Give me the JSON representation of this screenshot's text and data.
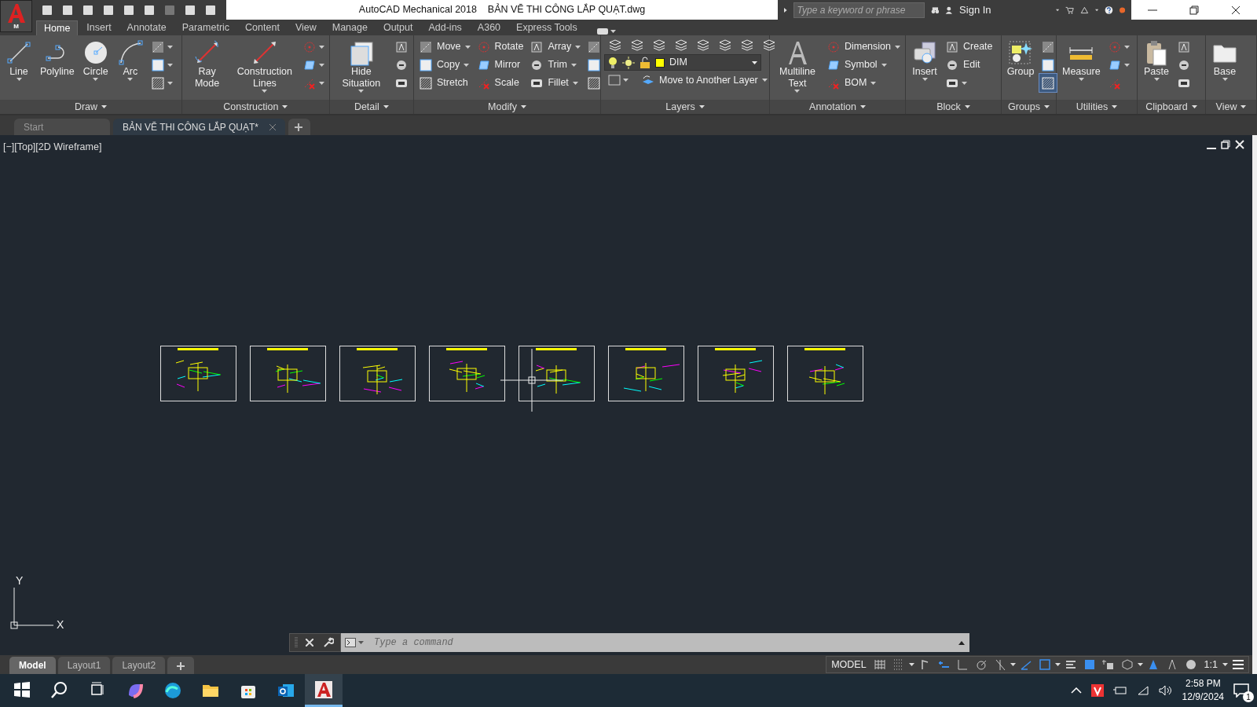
{
  "title_bar": {
    "app_letter": "M",
    "title": "AutoCAD Mechanical 2018    BẢN VẼ THI CÔNG LẮP QUẠT.dwg",
    "search": {
      "placeholder": "Type a keyword or phrase"
    },
    "sign_in": "Sign In"
  },
  "ribbon_tabs": [
    {
      "label": "Home",
      "selected": true
    },
    {
      "label": "Insert",
      "selected": false
    },
    {
      "label": "Annotate",
      "selected": false
    },
    {
      "label": "Parametric",
      "selected": false
    },
    {
      "label": "Content",
      "selected": false
    },
    {
      "label": "View",
      "selected": false
    },
    {
      "label": "Manage",
      "selected": false
    },
    {
      "label": "Output",
      "selected": false
    },
    {
      "label": "Add-ins",
      "selected": false
    },
    {
      "label": "A360",
      "selected": false
    },
    {
      "label": "Express Tools",
      "selected": false
    }
  ],
  "panels": [
    {
      "title": "Draw",
      "kind": "tools",
      "items": [
        {
          "kind": "large",
          "label": "Line",
          "dropdown": true
        },
        {
          "kind": "large",
          "label": "Polyline",
          "dropdown": false
        },
        {
          "kind": "large",
          "label": "Circle",
          "dropdown": true
        },
        {
          "kind": "large",
          "label": "Arc",
          "dropdown": true
        },
        {
          "kind": "icon",
          "dropdown": true
        },
        {
          "kind": "icon",
          "dropdown": true
        },
        {
          "kind": "icon",
          "dropdown": true
        }
      ]
    },
    {
      "title": "Construction",
      "kind": "tools",
      "items": [
        {
          "kind": "large",
          "label": "Ray Mode",
          "dropdown": false
        },
        {
          "kind": "large",
          "label": "Construction Lines",
          "dropdown": true
        },
        {
          "kind": "icon",
          "dropdown": true
        },
        {
          "kind": "icon",
          "dropdown": true
        },
        {
          "kind": "icon",
          "dropdown": true
        }
      ]
    },
    {
      "title": "Detail",
      "kind": "tools",
      "items": [
        {
          "kind": "large",
          "label": "Hide Situation",
          "dropdown": true
        },
        {
          "kind": "icon",
          "dropdown": false
        },
        {
          "kind": "icon",
          "dropdown": false
        },
        {
          "kind": "icon",
          "dropdown": false
        }
      ]
    },
    {
      "title": "Modify",
      "kind": "tools",
      "items": [
        {
          "kind": "small",
          "label": "Move",
          "dropdown": true
        },
        {
          "kind": "small",
          "label": "Copy",
          "dropdown": true
        },
        {
          "kind": "small",
          "label": "Stretch",
          "dropdown": false
        },
        {
          "kind": "small",
          "label": "Rotate",
          "dropdown": false
        },
        {
          "kind": "small",
          "label": "Mirror",
          "dropdown": false
        },
        {
          "kind": "small",
          "label": "Scale",
          "dropdown": false
        },
        {
          "kind": "small",
          "label": "Array",
          "dropdown": true
        },
        {
          "kind": "small",
          "label": "Trim",
          "dropdown": true
        },
        {
          "kind": "small",
          "label": "Fillet",
          "dropdown": true
        },
        {
          "kind": "icon",
          "dropdown": false
        },
        {
          "kind": "icon",
          "dropdown": false
        },
        {
          "kind": "icon",
          "dropdown": false
        }
      ]
    },
    {
      "title": "Layers",
      "kind": "layers",
      "layer": "DIM",
      "action": "Move to Another Layer"
    },
    {
      "title": "Annotation",
      "kind": "tools",
      "items": [
        {
          "kind": "large",
          "label": "Multiline Text",
          "dropdown": true
        },
        {
          "kind": "small",
          "label": "Dimension",
          "dropdown": true
        },
        {
          "kind": "small",
          "label": "Symbol",
          "dropdown": true
        },
        {
          "kind": "small",
          "label": "BOM",
          "dropdown": true
        }
      ]
    },
    {
      "title": "Block",
      "kind": "tools",
      "items": [
        {
          "kind": "large",
          "label": "Insert",
          "dropdown": true
        },
        {
          "kind": "small",
          "label": "Create",
          "dropdown": false
        },
        {
          "kind": "small",
          "label": "Edit",
          "dropdown": false
        },
        {
          "kind": "icon",
          "dropdown": true
        }
      ]
    },
    {
      "title": "Groups",
      "kind": "tools",
      "items": [
        {
          "kind": "large",
          "label": "Group",
          "dropdown": false,
          "on": false
        },
        {
          "kind": "icon",
          "dropdown": false,
          "on": false
        },
        {
          "kind": "icon",
          "dropdown": false,
          "on": false
        },
        {
          "kind": "icon",
          "dropdown": false,
          "on": true
        }
      ]
    },
    {
      "title": "Utilities",
      "kind": "tools",
      "items": [
        {
          "kind": "large",
          "label": "Measure",
          "dropdown": true
        },
        {
          "kind": "icon",
          "dropdown": true
        },
        {
          "kind": "icon",
          "dropdown": true
        },
        {
          "kind": "icon",
          "dropdown": false
        }
      ]
    },
    {
      "title": "Clipboard",
      "kind": "tools",
      "items": [
        {
          "kind": "large",
          "label": "Paste",
          "dropdown": true
        },
        {
          "kind": "icon",
          "dropdown": false
        },
        {
          "kind": "icon",
          "dropdown": false
        },
        {
          "kind": "icon",
          "dropdown": false
        }
      ]
    },
    {
      "title": "View",
      "kind": "tools",
      "items": [
        {
          "kind": "large",
          "label": "Base",
          "dropdown": true
        }
      ]
    }
  ],
  "doc_tabs": [
    {
      "label": "Start",
      "selected": false
    },
    {
      "label": "BẢN VẼ THI CÔNG LẮP QUẠT*",
      "selected": true
    }
  ],
  "viewport": {
    "label": "[−][Top][2D Wireframe]",
    "ucs": {
      "y": "Y",
      "x": "X"
    }
  },
  "command_line": {
    "placeholder": "Type a command"
  },
  "layout_tabs": [
    {
      "label": "Model",
      "selected": true
    },
    {
      "label": "Layout1",
      "selected": false
    },
    {
      "label": "Layout2",
      "selected": false
    }
  ],
  "status_bar": {
    "space": "MODEL",
    "scale": "1:1",
    "toggles": [
      {
        "on": false
      },
      {
        "on": false
      },
      {
        "on": false
      },
      {
        "on": true
      },
      {
        "on": false
      },
      {
        "on": false
      },
      {
        "on": false
      },
      {
        "on": true
      },
      {
        "on": true
      },
      {
        "on": false
      },
      {
        "on": true
      },
      {
        "on": false
      },
      {
        "on": false
      },
      {
        "on": true
      },
      {
        "on": false
      },
      {
        "on": false
      }
    ]
  },
  "taskbar": {
    "time": "2:58 PM",
    "date": "12/9/2024",
    "notifications": "1"
  }
}
